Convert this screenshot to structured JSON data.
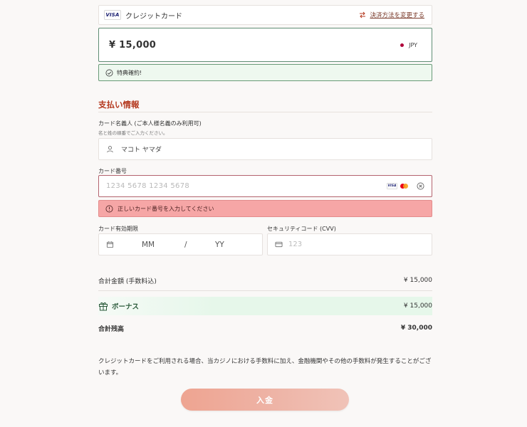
{
  "payment_method": {
    "brand_badge": "VISA",
    "label": "クレジットカード",
    "change_link": "決済方法を変更する"
  },
  "amount": {
    "value": "¥ 15,000",
    "currency": "JPY"
  },
  "bonus_applied": {
    "text": "特典確約!"
  },
  "section": {
    "title": "支払い情報"
  },
  "card_holder": {
    "label": "カード名義人 (ご本人様名義のみ利用可)",
    "sublabel": "名と姓の順番でご入力ください。",
    "value": "マコト ヤマダ"
  },
  "card_number": {
    "label": "カード番号",
    "placeholder": "1234 5678 1234 5678",
    "brand_visa": "VISA"
  },
  "error": {
    "text": "正しいカード番号を入力してください"
  },
  "expiry": {
    "label": "カード有効期限",
    "mm": "MM",
    "slash": "/",
    "yy": "YY"
  },
  "cvv": {
    "label": "セキュリティコード (CVV)",
    "placeholder": "123"
  },
  "summary": {
    "total_label": "合計金額 (手数料込)",
    "total_value": "¥ 15,000",
    "bonus_label": "ボーナス",
    "bonus_value": "¥ 15,000",
    "balance_label": "合計残高",
    "balance_value": "¥ 30,000"
  },
  "notice": "クレジットカードをご利用される場合、当カジノにおける手数料に加え、金融機関やその他の手数料が発生することがございます。",
  "deposit_button": "入金",
  "colors": {
    "accent": "#b53a20",
    "success_border": "#5f8d74",
    "error_bg": "#f6a6a6",
    "button": "#eea491"
  }
}
